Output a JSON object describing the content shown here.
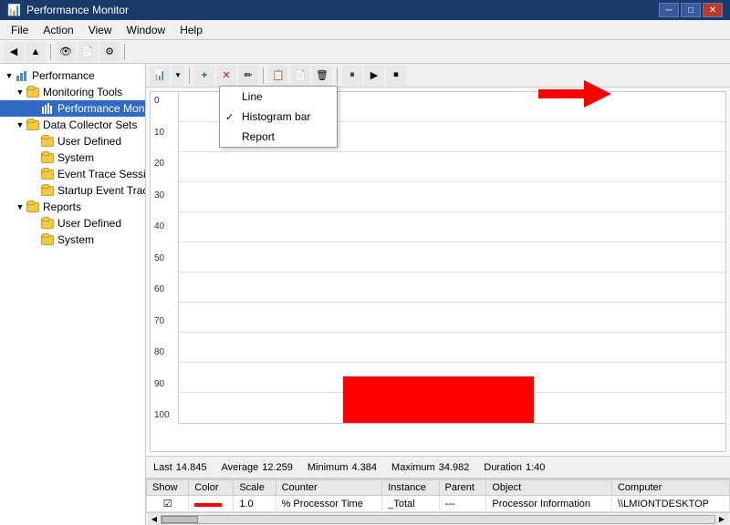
{
  "titleBar": {
    "title": "Performance Monitor",
    "icon": "📊",
    "controls": [
      "minimize",
      "maximize",
      "close"
    ]
  },
  "menuBar": {
    "items": [
      "File",
      "Action",
      "View",
      "Window",
      "Help"
    ]
  },
  "sidebar": {
    "tree": [
      {
        "id": "performance",
        "label": "Performance",
        "expanded": true,
        "children": [
          {
            "id": "monitoring-tools",
            "label": "Monitoring Tools",
            "expanded": true,
            "children": [
              {
                "id": "performance-monitor",
                "label": "Performance Monitor",
                "selected": true
              }
            ]
          },
          {
            "id": "data-collector-sets",
            "label": "Data Collector Sets",
            "expanded": true,
            "children": [
              {
                "id": "user-defined-dcs",
                "label": "User Defined"
              },
              {
                "id": "system-dcs",
                "label": "System"
              },
              {
                "id": "event-trace",
                "label": "Event Trace Sessions"
              },
              {
                "id": "startup-event",
                "label": "Startup Event Trace Sess..."
              }
            ]
          },
          {
            "id": "reports",
            "label": "Reports",
            "expanded": true,
            "children": [
              {
                "id": "user-defined-rep",
                "label": "User Defined"
              },
              {
                "id": "system-rep",
                "label": "System"
              }
            ]
          }
        ]
      }
    ]
  },
  "chartToolbar": {
    "buttons": [
      "view",
      "properties",
      "add",
      "delete",
      "highlight",
      "copy",
      "paste",
      "clear",
      "freeze",
      "play",
      "stop",
      "next"
    ]
  },
  "dropdown": {
    "visible": true,
    "items": [
      {
        "label": "Line",
        "checked": false
      },
      {
        "label": "Histogram bar",
        "checked": true
      },
      {
        "label": "Report",
        "checked": false
      }
    ]
  },
  "chart": {
    "yAxis": [
      "100",
      "90",
      "80",
      "70",
      "60",
      "50",
      "40",
      "30",
      "20",
      "10",
      "0"
    ],
    "bar": {
      "left_pct": 30,
      "width_pct": 35,
      "height_pct": 14,
      "color": "red"
    }
  },
  "stats": {
    "last_label": "Last",
    "last_value": "14.845",
    "average_label": "Average",
    "average_value": "12.259",
    "minimum_label": "Minimum",
    "minimum_value": "4.384",
    "maximum_label": "Maximum",
    "maximum_value": "34.982",
    "duration_label": "Duration",
    "duration_value": "1:40"
  },
  "table": {
    "columns": [
      "Show",
      "Color",
      "Scale",
      "Counter",
      "Instance",
      "Parent",
      "Object",
      "Computer"
    ],
    "rows": [
      {
        "show": "☑",
        "color": "red",
        "scale": "1.0",
        "counter": "% Processor Time",
        "instance": "_Total",
        "parent": "---",
        "object": "Processor Information",
        "computer": "\\\\LMIONTDESKTOP"
      }
    ]
  }
}
